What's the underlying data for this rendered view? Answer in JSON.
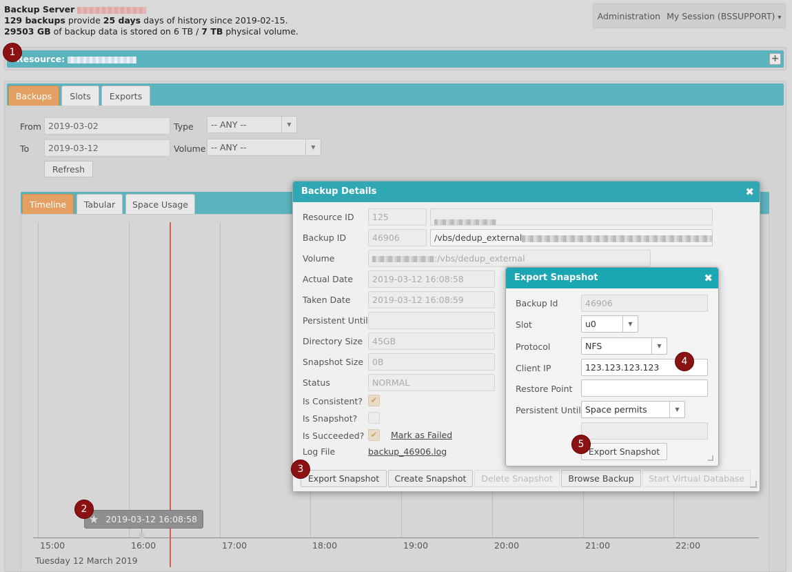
{
  "header": {
    "title": "Backup Server",
    "line1_count": "129 backups",
    "line1_mid": "provide",
    "line1_days": "25 days",
    "line1_rest": "days of history since 2019-02-15.",
    "line2_size": "29503 GB",
    "line2_mid": "of backup data is stored on 6 TB /",
    "line2_total": "7 TB",
    "line2_rest": "physical volume."
  },
  "topnav": {
    "admin": "Administration",
    "session": "My Session (BSSUPPORT)",
    "caret": "▾"
  },
  "resource_bar": {
    "label": "Resource:",
    "plus": "+"
  },
  "tabs": [
    {
      "label": "Backups"
    },
    {
      "label": "Slots"
    },
    {
      "label": "Exports"
    }
  ],
  "filters": {
    "from_label": "From",
    "from_value": "2019-03-02",
    "to_label": "To",
    "to_value": "2019-03-12",
    "type_label": "Type",
    "type_value": "-- ANY --",
    "volume_label": "Volume",
    "volume_value": "-- ANY --",
    "refresh": "Refresh"
  },
  "view_tabs": [
    {
      "label": "Timeline"
    },
    {
      "label": "Tabular"
    },
    {
      "label": "Space Usage"
    }
  ],
  "timeline": {
    "ticks": [
      "15:00",
      "16:00",
      "17:00",
      "18:00",
      "19:00",
      "20:00",
      "21:00",
      "22:00"
    ],
    "date_label": "Tuesday 12 March 2019",
    "event_label": "2019-03-12 16:08:58",
    "event_icon": "★"
  },
  "backup_details": {
    "title": "Backup Details",
    "close": "✖",
    "resource_id_label": "Resource ID",
    "resource_id": "125",
    "backup_id_label": "Backup ID",
    "backup_id": "46906",
    "backup_path": "/vbs/dedup_external",
    "volume_label": "Volume",
    "volume_path": ":/vbs/dedup_external",
    "actual_date_label": "Actual Date",
    "actual_date": "2019-03-12 16:08:58",
    "taken_date_label": "Taken Date",
    "taken_date": "2019-03-12 16:08:59",
    "persistent_until_label": "Persistent Until",
    "persistent_until": "",
    "directory_size_label": "Directory Size",
    "directory_size": "45GB",
    "snapshot_size_label": "Snapshot Size",
    "snapshot_size": "0B",
    "status_label": "Status",
    "status": "NORMAL",
    "is_consistent_label": "Is Consistent?",
    "is_snapshot_label": "Is Snapshot?",
    "is_succeeded_label": "Is Succeeded?",
    "mark_failed": "Mark as Failed",
    "check": "✔",
    "log_file_label": "Log File",
    "log_file": "backup_46906.log",
    "buttons": {
      "export_snapshot": "Export Snapshot",
      "create_snapshot": "Create Snapshot",
      "delete_snapshot": "Delete Snapshot",
      "browse_backup": "Browse Backup",
      "start_virtual_db": "Start Virtual Database"
    }
  },
  "export_snapshot": {
    "title": "Export Snapshot",
    "close": "✖",
    "backup_id_label": "Backup Id",
    "backup_id": "46906",
    "slot_label": "Slot",
    "slot": "u0",
    "protocol_label": "Protocol",
    "protocol": "NFS",
    "client_ip_label": "Client IP",
    "client_ip": "123.123.123.123",
    "restore_point_label": "Restore Point",
    "restore_point": "",
    "persistent_until_label": "Persistent Until",
    "persistent_until": "Space permits",
    "submit": "Export Snapshot",
    "caret": "▼"
  },
  "callouts": [
    "1",
    "2",
    "3",
    "4",
    "5"
  ],
  "colors": {
    "teal": "#5bb3bd",
    "modal_header": "#30a7b4",
    "active_tab": "#e3a062",
    "callout": "#8b1212",
    "now_line": "#e0584a"
  }
}
